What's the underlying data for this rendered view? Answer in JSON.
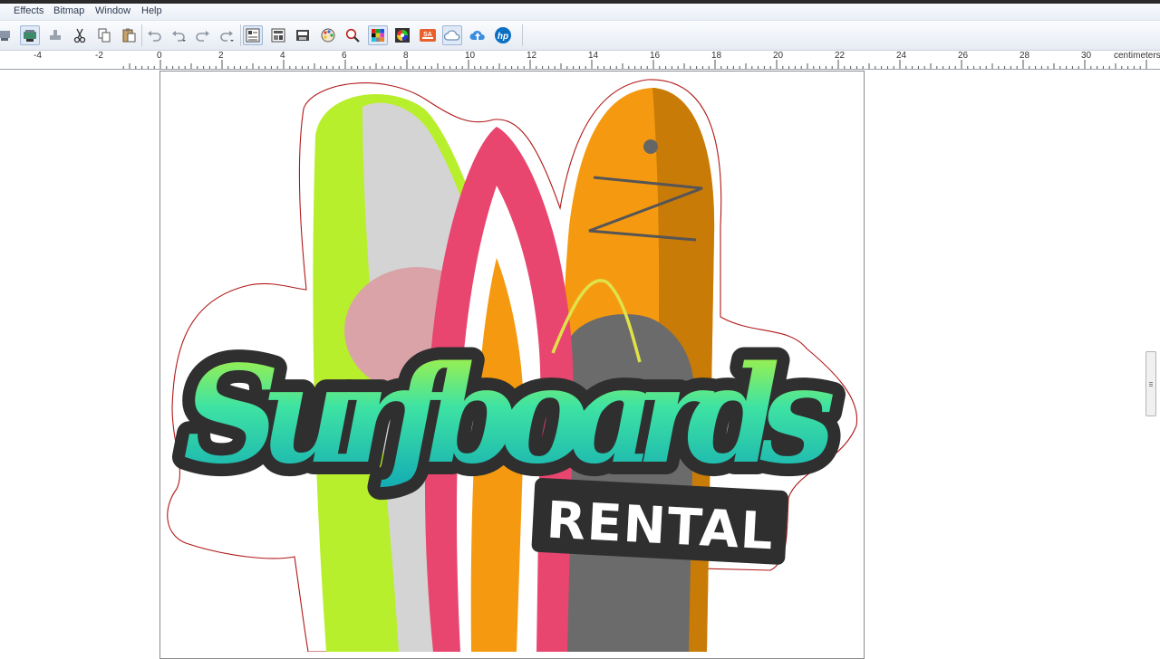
{
  "menu": {
    "items": [
      "Effects",
      "Bitmap",
      "Window",
      "Help"
    ]
  },
  "toolbar": {
    "icons": [
      "plotter-icon",
      "cutter-icon",
      "weed-icon",
      "cut-icon",
      "copy-icon",
      "paste-icon",
      "undo-icon",
      "undo-list-icon",
      "redo-icon",
      "redo-list-icon",
      "align-icon",
      "arrange-icon",
      "save-template-icon",
      "color-palette-icon",
      "zoom-icon",
      "color-grid-icon",
      "color-wheel-icon",
      "sa-icon",
      "cloud-icon",
      "cloud-upload-icon",
      "hp-icon"
    ]
  },
  "ruler": {
    "unit": "centimeters",
    "labels": [
      "-4",
      "-2",
      "0",
      "2",
      "4",
      "6",
      "8",
      "10",
      "12",
      "14",
      "16",
      "18",
      "20",
      "22",
      "24",
      "26",
      "28",
      "30"
    ]
  },
  "artwork": {
    "title_text": "Surfboards",
    "subtitle_text": "RENTAL",
    "colors": {
      "teal": "#2cc9a8",
      "lime": "#b8ef2c",
      "orange": "#f59a10",
      "pink": "#e8466e",
      "charcoal": "#333333",
      "cut_line": "#b01818"
    }
  }
}
